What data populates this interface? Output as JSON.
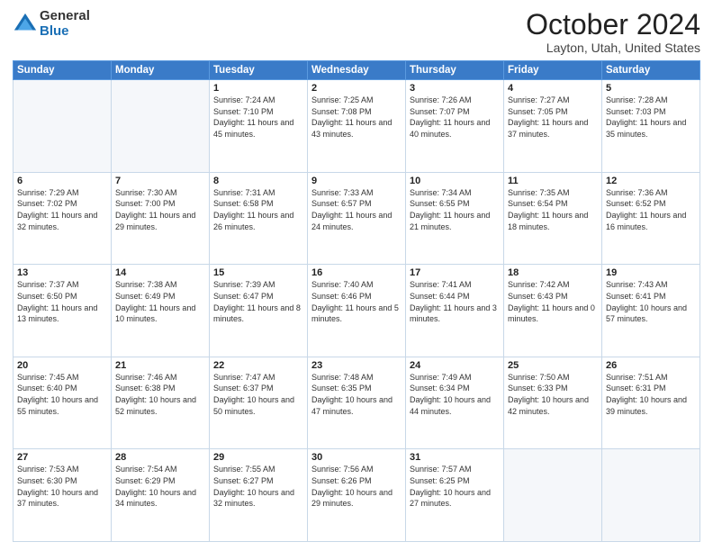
{
  "logo": {
    "general": "General",
    "blue": "Blue"
  },
  "title": {
    "month": "October 2024",
    "location": "Layton, Utah, United States"
  },
  "weekdays": [
    "Sunday",
    "Monday",
    "Tuesday",
    "Wednesday",
    "Thursday",
    "Friday",
    "Saturday"
  ],
  "weeks": [
    [
      {
        "day": "",
        "empty": true
      },
      {
        "day": "",
        "empty": true
      },
      {
        "day": "1",
        "sunrise": "7:24 AM",
        "sunset": "7:10 PM",
        "daylight": "11 hours and 45 minutes."
      },
      {
        "day": "2",
        "sunrise": "7:25 AM",
        "sunset": "7:08 PM",
        "daylight": "11 hours and 43 minutes."
      },
      {
        "day": "3",
        "sunrise": "7:26 AM",
        "sunset": "7:07 PM",
        "daylight": "11 hours and 40 minutes."
      },
      {
        "day": "4",
        "sunrise": "7:27 AM",
        "sunset": "7:05 PM",
        "daylight": "11 hours and 37 minutes."
      },
      {
        "day": "5",
        "sunrise": "7:28 AM",
        "sunset": "7:03 PM",
        "daylight": "11 hours and 35 minutes."
      }
    ],
    [
      {
        "day": "6",
        "sunrise": "7:29 AM",
        "sunset": "7:02 PM",
        "daylight": "11 hours and 32 minutes."
      },
      {
        "day": "7",
        "sunrise": "7:30 AM",
        "sunset": "7:00 PM",
        "daylight": "11 hours and 29 minutes."
      },
      {
        "day": "8",
        "sunrise": "7:31 AM",
        "sunset": "6:58 PM",
        "daylight": "11 hours and 26 minutes."
      },
      {
        "day": "9",
        "sunrise": "7:33 AM",
        "sunset": "6:57 PM",
        "daylight": "11 hours and 24 minutes."
      },
      {
        "day": "10",
        "sunrise": "7:34 AM",
        "sunset": "6:55 PM",
        "daylight": "11 hours and 21 minutes."
      },
      {
        "day": "11",
        "sunrise": "7:35 AM",
        "sunset": "6:54 PM",
        "daylight": "11 hours and 18 minutes."
      },
      {
        "day": "12",
        "sunrise": "7:36 AM",
        "sunset": "6:52 PM",
        "daylight": "11 hours and 16 minutes."
      }
    ],
    [
      {
        "day": "13",
        "sunrise": "7:37 AM",
        "sunset": "6:50 PM",
        "daylight": "11 hours and 13 minutes."
      },
      {
        "day": "14",
        "sunrise": "7:38 AM",
        "sunset": "6:49 PM",
        "daylight": "11 hours and 10 minutes."
      },
      {
        "day": "15",
        "sunrise": "7:39 AM",
        "sunset": "6:47 PM",
        "daylight": "11 hours and 8 minutes."
      },
      {
        "day": "16",
        "sunrise": "7:40 AM",
        "sunset": "6:46 PM",
        "daylight": "11 hours and 5 minutes."
      },
      {
        "day": "17",
        "sunrise": "7:41 AM",
        "sunset": "6:44 PM",
        "daylight": "11 hours and 3 minutes."
      },
      {
        "day": "18",
        "sunrise": "7:42 AM",
        "sunset": "6:43 PM",
        "daylight": "11 hours and 0 minutes."
      },
      {
        "day": "19",
        "sunrise": "7:43 AM",
        "sunset": "6:41 PM",
        "daylight": "10 hours and 57 minutes."
      }
    ],
    [
      {
        "day": "20",
        "sunrise": "7:45 AM",
        "sunset": "6:40 PM",
        "daylight": "10 hours and 55 minutes."
      },
      {
        "day": "21",
        "sunrise": "7:46 AM",
        "sunset": "6:38 PM",
        "daylight": "10 hours and 52 minutes."
      },
      {
        "day": "22",
        "sunrise": "7:47 AM",
        "sunset": "6:37 PM",
        "daylight": "10 hours and 50 minutes."
      },
      {
        "day": "23",
        "sunrise": "7:48 AM",
        "sunset": "6:35 PM",
        "daylight": "10 hours and 47 minutes."
      },
      {
        "day": "24",
        "sunrise": "7:49 AM",
        "sunset": "6:34 PM",
        "daylight": "10 hours and 44 minutes."
      },
      {
        "day": "25",
        "sunrise": "7:50 AM",
        "sunset": "6:33 PM",
        "daylight": "10 hours and 42 minutes."
      },
      {
        "day": "26",
        "sunrise": "7:51 AM",
        "sunset": "6:31 PM",
        "daylight": "10 hours and 39 minutes."
      }
    ],
    [
      {
        "day": "27",
        "sunrise": "7:53 AM",
        "sunset": "6:30 PM",
        "daylight": "10 hours and 37 minutes."
      },
      {
        "day": "28",
        "sunrise": "7:54 AM",
        "sunset": "6:29 PM",
        "daylight": "10 hours and 34 minutes."
      },
      {
        "day": "29",
        "sunrise": "7:55 AM",
        "sunset": "6:27 PM",
        "daylight": "10 hours and 32 minutes."
      },
      {
        "day": "30",
        "sunrise": "7:56 AM",
        "sunset": "6:26 PM",
        "daylight": "10 hours and 29 minutes."
      },
      {
        "day": "31",
        "sunrise": "7:57 AM",
        "sunset": "6:25 PM",
        "daylight": "10 hours and 27 minutes."
      },
      {
        "day": "",
        "empty": true
      },
      {
        "day": "",
        "empty": true
      }
    ]
  ]
}
